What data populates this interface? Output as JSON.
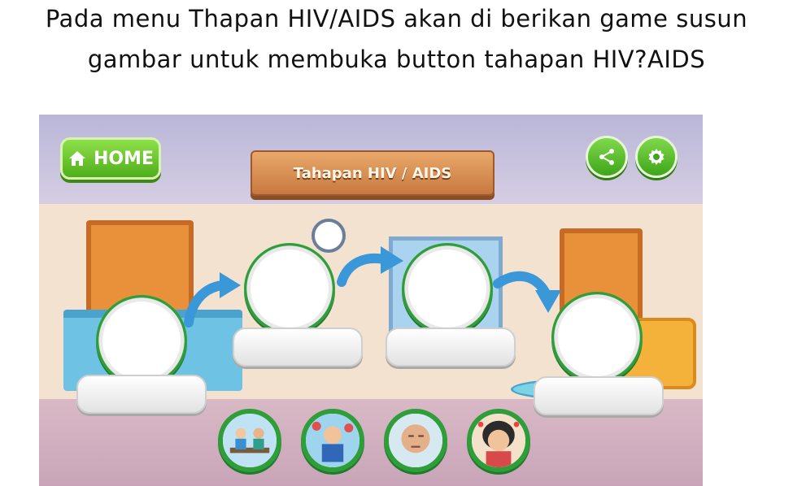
{
  "caption": {
    "line1": "Pada menu Thapan HIV/AIDS akan di berikan game susun",
    "line2": "gambar untuk membuka button tahapan HIV?AIDS"
  },
  "game": {
    "home_label": "HOME",
    "title": "Tahapan HIV / AIDS",
    "icons": {
      "home": "house-icon",
      "share": "share-icon",
      "settings": "gear-icon"
    },
    "colors": {
      "green": "#4fae1a",
      "wood": "#c8793f",
      "stage_ring": "#2f9e3a"
    },
    "stages": [
      {
        "label": ""
      },
      {
        "label": ""
      },
      {
        "label": ""
      },
      {
        "label": ""
      }
    ],
    "puzzle_pieces": [
      {
        "icon": "doctor-consultation-icon"
      },
      {
        "icon": "sick-person-icon"
      },
      {
        "icon": "tired-man-icon"
      },
      {
        "icon": "ill-woman-icon"
      }
    ]
  }
}
